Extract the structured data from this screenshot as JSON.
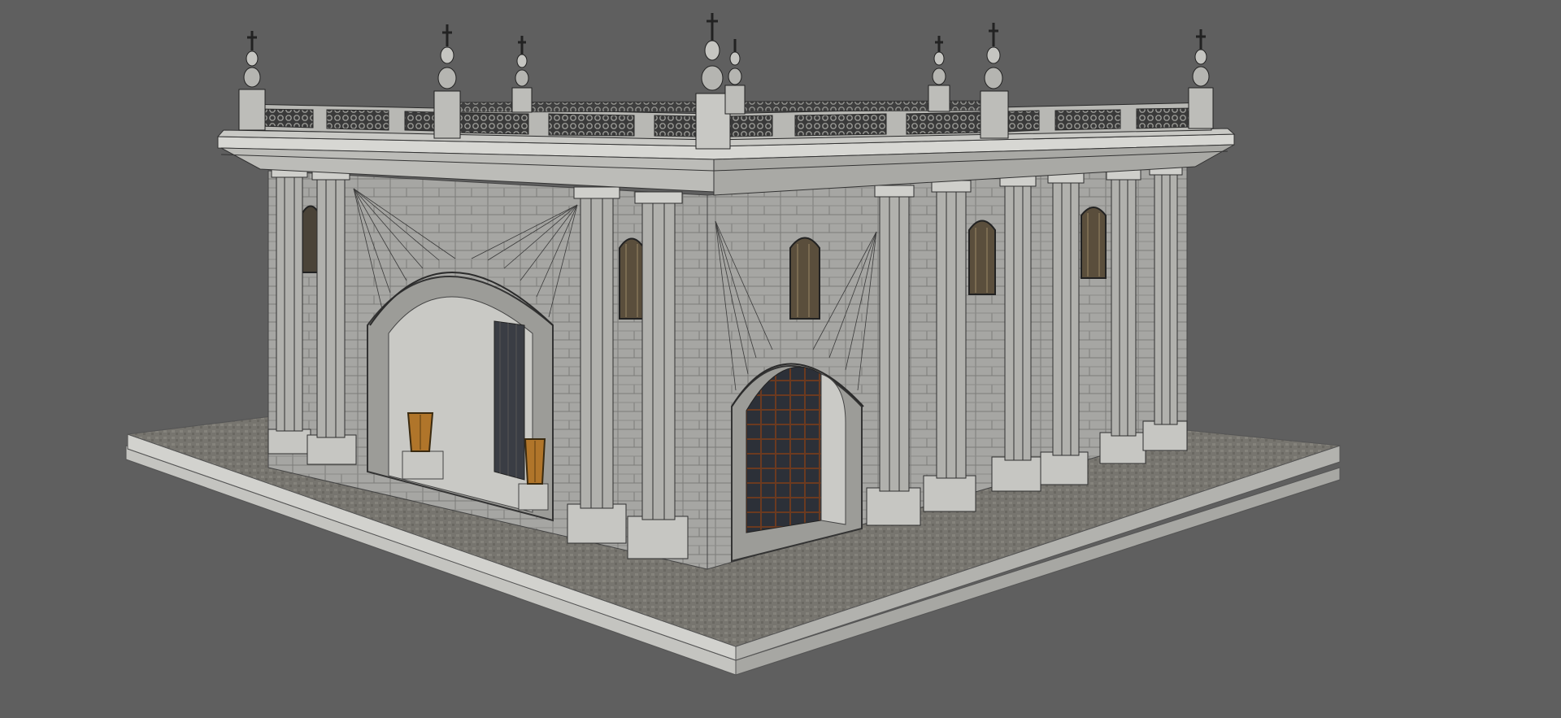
{
  "viewport": {
    "background": "#5f5f5f",
    "render_mode": "shaded-with-wireframe"
  },
  "model": {
    "subject": "classical-stone-pavilion",
    "materials": {
      "stone": "#a9a9a6",
      "stone_light": "#c8c8c4",
      "stone_dark": "#7d7d7a",
      "pavement": "#77756f",
      "wire": "#2b2b2b",
      "glass": "#2c3038",
      "wood": "#6b3a20",
      "lantern": "#b0752a"
    }
  }
}
